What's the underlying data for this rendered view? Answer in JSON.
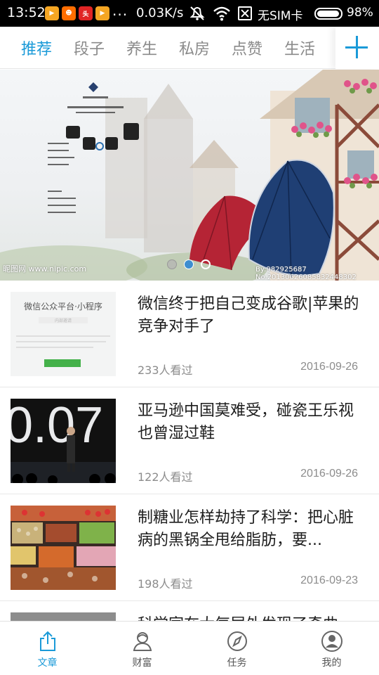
{
  "status_bar": {
    "time": "13:52",
    "dots": "...",
    "net_speed": "0.03K/s",
    "sim_status": "无SIM卡",
    "battery": "98%",
    "battery_level": 0.98,
    "app_icons": [
      {
        "name": "video-app-icon",
        "color": "#f5a623"
      },
      {
        "name": "cat-app-icon",
        "color": "#ff6d00"
      },
      {
        "name": "headline-app-icon",
        "color": "#e02424"
      },
      {
        "name": "video-app-icon-2",
        "color": "#f5a623"
      }
    ],
    "icons": [
      "mute-icon",
      "wifi-icon",
      "no-sim-icon",
      "battery-icon"
    ]
  },
  "tabs": [
    {
      "label": "推荐",
      "active": true
    },
    {
      "label": "段子",
      "active": false
    },
    {
      "label": "养生",
      "active": false
    },
    {
      "label": "私房",
      "active": false
    },
    {
      "label": "点赞",
      "active": false
    },
    {
      "label": "生活",
      "active": false
    }
  ],
  "tab_add_icon": "plus-icon",
  "banner": {
    "watermark_left": "昵图网 www.nipic.com",
    "watermark_right": "By:982925687 No.20130626085832448302",
    "dots": [
      "dim",
      "active",
      "hollow"
    ]
  },
  "articles": [
    {
      "title": "微信终于把自己变成谷歌|苹果的竞争对手了",
      "views": "233人看过",
      "date": "2016-09-26",
      "thumb_heading": "微信公众平台·小程序",
      "thumb_sub": "内部邀请",
      "thumb_button": "申请开通"
    },
    {
      "title": "亚马逊中国莫难受，碰瓷王乐视也曾湿过鞋",
      "views": "122人看过",
      "date": "2016-09-26",
      "thumb_text": "0.07"
    },
    {
      "title": "制糖业怎样劫持了科学：把心脏病的黑锅全甩给脂肪，要...",
      "views": "198人看过",
      "date": "2016-09-23"
    },
    {
      "title": "科学家在大气层外发现了奇曲",
      "views": "",
      "date": ""
    }
  ],
  "bottom_nav": [
    {
      "label": "文章",
      "icon": "share-upload-icon",
      "active": true
    },
    {
      "label": "财富",
      "icon": "user-wealth-icon",
      "active": false
    },
    {
      "label": "任务",
      "icon": "compass-task-icon",
      "active": false
    },
    {
      "label": "我的",
      "icon": "profile-icon",
      "active": false
    }
  ],
  "colors": {
    "accent": "#1a9ad8",
    "text_primary": "#1d1d1d",
    "text_secondary": "#8c8c8c",
    "inactive_tab": "#8a8a8a"
  }
}
